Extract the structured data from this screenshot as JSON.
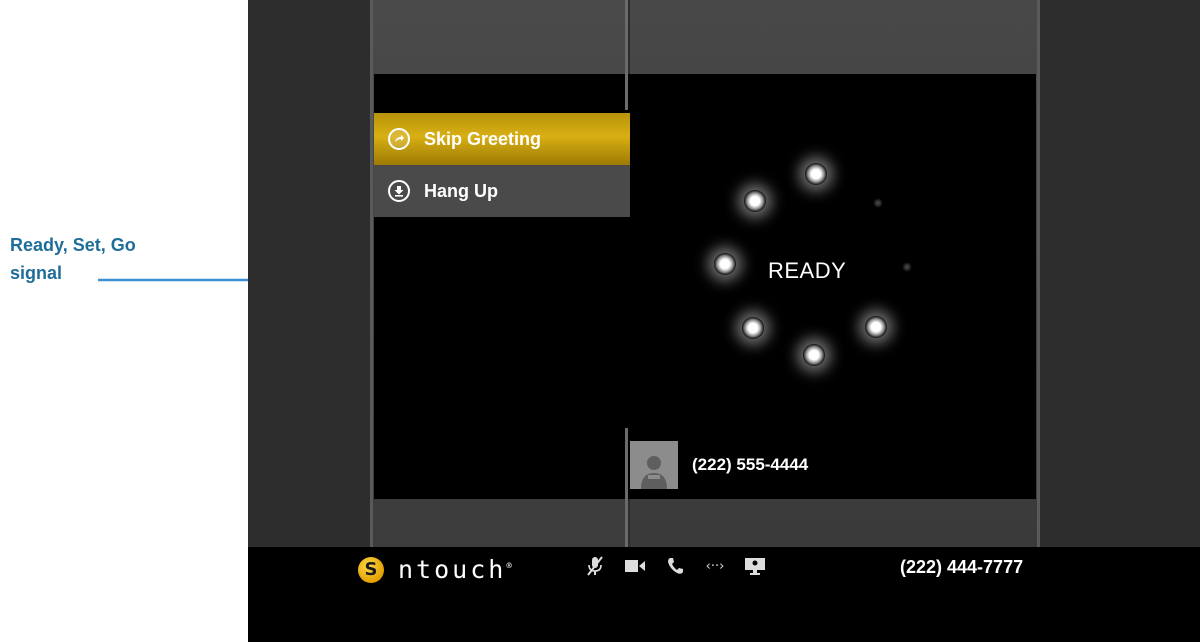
{
  "callout": {
    "line1": "Ready, Set, Go",
    "line2": "signal",
    "color": "#1f6e99"
  },
  "menu": {
    "skip_label": "Skip Greeting",
    "skip_icon": "skip-arrow-icon",
    "hang_label": "Hang Up",
    "hang_icon": "hang-up-down-arrow-icon",
    "accent": "#d8af13"
  },
  "video": {
    "status_text": "READY"
  },
  "caller": {
    "number": "(222) 555-4444",
    "avatar_icon": "person-icon"
  },
  "toolbar": {
    "brand": "ntouch",
    "brand_mark": "S",
    "icons": [
      "mic-muted-icon",
      "video-camera-icon",
      "phone-icon",
      "share-text-icon",
      "screen-share-icon"
    ],
    "share_text_glyph": "‹··›",
    "own_number": "(222) 444-7777"
  }
}
